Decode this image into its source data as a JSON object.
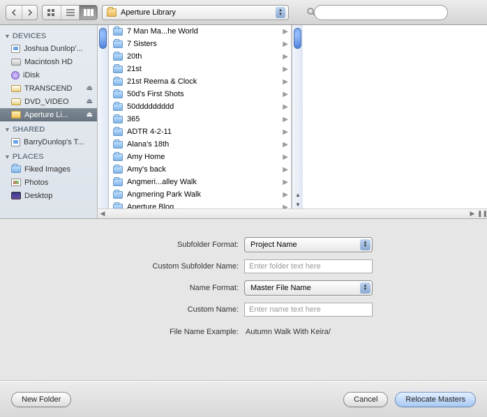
{
  "toolbar": {
    "path_label": "Aperture Library",
    "search_placeholder": ""
  },
  "sidebar": {
    "sections": [
      {
        "title": "DEVICES",
        "items": [
          {
            "label": "Joshua Dunlop'...",
            "icon": "mac",
            "eject": false
          },
          {
            "label": "Macintosh HD",
            "icon": "hd",
            "eject": false
          },
          {
            "label": "iDisk",
            "icon": "idisk",
            "eject": false
          },
          {
            "label": "TRANSCEND",
            "icon": "ext",
            "eject": true
          },
          {
            "label": "DVD_VIDEO",
            "icon": "ext",
            "eject": true
          },
          {
            "label": "Aperture Li...",
            "icon": "app",
            "eject": true,
            "selected": true
          }
        ]
      },
      {
        "title": "SHARED",
        "items": [
          {
            "label": "BarryDunlop's T...",
            "icon": "mac",
            "eject": false
          }
        ]
      },
      {
        "title": "PLACES",
        "items": [
          {
            "label": "Fiked Images",
            "icon": "folder",
            "eject": false
          },
          {
            "label": "Photos",
            "icon": "photos",
            "eject": false
          },
          {
            "label": "Desktop",
            "icon": "desktop",
            "eject": false
          }
        ]
      }
    ]
  },
  "folders": [
    "7 Man Ma...he World",
    "7 Sisters",
    "20th",
    "21st",
    "21st Reema & Clock",
    "50d's First Shots",
    "50ddddddddd",
    "365",
    "ADTR 4-2-11",
    "Alana's 18th",
    "Amy Home",
    "Amy's back",
    "Angmeri...alley Walk",
    "Angmering Park Walk",
    "Aperture Blog"
  ],
  "form": {
    "subfolder_format_label": "Subfolder Format:",
    "subfolder_format_value": "Project Name",
    "custom_subfolder_label": "Custom Subfolder Name:",
    "custom_subfolder_placeholder": "Enter folder text here",
    "name_format_label": "Name Format:",
    "name_format_value": "Master File Name",
    "custom_name_label": "Custom Name:",
    "custom_name_placeholder": "Enter name text here",
    "example_label": "File Name Example:",
    "example_value": "Autumn Walk With Keira/"
  },
  "buttons": {
    "new_folder": "New Folder",
    "cancel": "Cancel",
    "relocate": "Relocate Masters"
  }
}
